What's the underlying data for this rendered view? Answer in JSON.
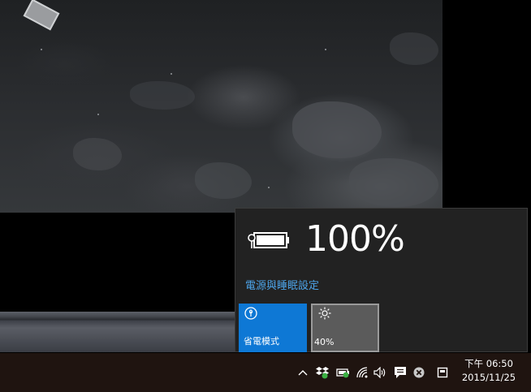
{
  "flyout": {
    "battery_percent": "100%",
    "battery_level": 100,
    "power_settings_link": "電源與睡眠設定",
    "tiles": {
      "battery_saver": {
        "label": "省電模式",
        "active": true
      },
      "brightness": {
        "label": "40%"
      }
    }
  },
  "taskbar": {
    "clock": {
      "time": "下午 06:50",
      "date": "2015/11/25"
    },
    "tray_icons": [
      "chevron-up-icon",
      "dropbox-icon",
      "battery-charging-icon",
      "wifi-icon",
      "volume-icon",
      "notification-icon",
      "error-icon",
      "action-center-icon"
    ]
  },
  "colors": {
    "accent": "#0e78d5",
    "link": "#4ca3e8",
    "flyout_bg": "#222222",
    "taskbar_bg": "#1f1410"
  }
}
